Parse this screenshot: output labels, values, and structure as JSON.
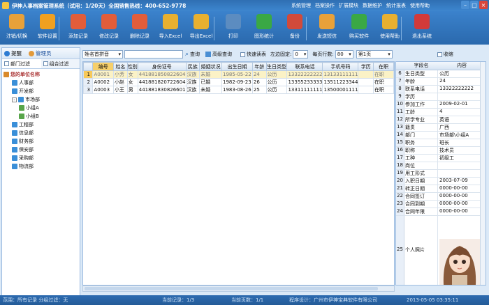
{
  "app": {
    "title": "伊神人事档案管理系统（试用：1/20天）全国销售热线：400-652-9778"
  },
  "menu": [
    "系统管理",
    "档案操作",
    "扩展模块",
    "数据维护",
    "统计报表",
    "使用帮助"
  ],
  "toolbar": [
    {
      "label": "注销/切换",
      "icon": "logout-switch-icon",
      "color": "#e8a13a"
    },
    {
      "label": "软件设置",
      "icon": "settings-gear-icon",
      "color": "#f0a020"
    },
    {
      "label": "添加记录",
      "icon": "add-record-icon",
      "color": "#e25d3a"
    },
    {
      "label": "修改记录",
      "icon": "edit-record-icon",
      "color": "#e25d3a"
    },
    {
      "label": "删除记录",
      "icon": "delete-record-icon",
      "color": "#e25d3a"
    },
    {
      "label": "导入Excel",
      "icon": "import-excel-icon",
      "color": "#e8b030"
    },
    {
      "label": "导出Excel",
      "icon": "export-excel-icon",
      "color": "#e8b030"
    },
    {
      "label": "打印",
      "icon": "print-icon",
      "color": "#5c8cc0"
    },
    {
      "label": "图形统计",
      "icon": "chart-stats-icon",
      "color": "#3aa845"
    },
    {
      "label": "备份",
      "icon": "backup-icon",
      "color": "#d24a3a"
    },
    {
      "label": "发送短信",
      "icon": "sms-envelope-icon",
      "color": "#e8a13a"
    },
    {
      "label": "购买软件",
      "icon": "buy-dollar-icon",
      "color": "#3aa845"
    },
    {
      "label": "使用帮助",
      "icon": "help-icon",
      "color": "#e8b030"
    },
    {
      "label": "退出系统",
      "icon": "exit-icon",
      "color": "#d23a3a"
    }
  ],
  "left": {
    "remind": "提醒",
    "admin": "管理员",
    "tab_dept": "部门过滤",
    "tab_group": "组合过滤",
    "tree": [
      {
        "label": "您的单位名称",
        "level": 0,
        "bold": true
      },
      {
        "label": "人事部",
        "level": 1
      },
      {
        "label": "开发部",
        "level": 1
      },
      {
        "label": "市场部",
        "level": 1,
        "plus": true
      },
      {
        "label": "小组A",
        "level": 2
      },
      {
        "label": "小组B",
        "level": 2
      },
      {
        "label": "工程部",
        "level": 1
      },
      {
        "label": "信息部",
        "level": 1
      },
      {
        "label": "财务部",
        "level": 1
      },
      {
        "label": "保安部",
        "level": 1
      },
      {
        "label": "采购部",
        "level": 1
      },
      {
        "label": "物流部",
        "level": 1
      }
    ]
  },
  "search": {
    "field": "姓名首拼音",
    "query_btn": "查询",
    "adv_btn": "高级查询",
    "quick_table": "快速读表",
    "left_fix_label": "左边固定:",
    "left_fix_value": "0",
    "per_page_label": "每页行数:",
    "per_page_value": "80",
    "page_value": "第1页",
    "collapse": "收缩"
  },
  "grid": {
    "headers": [
      "",
      "编号",
      "姓名",
      "性别",
      "身份证号",
      "民族",
      "婚姻状况",
      "出生日期",
      "年龄",
      "生日类型",
      "联系电话",
      "手机号码",
      "学历",
      "在职"
    ],
    "rows": [
      [
        "1",
        "A0001",
        "小芳",
        "女",
        "441881850822604",
        "汉族",
        "未婚",
        "1985-05-22",
        "24",
        "公历",
        "13322222222",
        "13133111111",
        "",
        "在职"
      ],
      [
        "2",
        "A0002",
        "小赵",
        "女",
        "441881820722604",
        "汉族",
        "已婚",
        "1982-09-23",
        "26",
        "公历",
        "13355233333",
        "13511223344",
        "",
        "在职"
      ],
      [
        "3",
        "A0003",
        "小王",
        "男",
        "441881830826601",
        "汉族",
        "未婚",
        "1983-08-26",
        "25",
        "公历",
        "13311111111",
        "13500001111",
        "",
        "在职"
      ]
    ]
  },
  "detail": {
    "head_field": "字段名",
    "head_value": "内容",
    "rows": [
      [
        "6",
        "生日类型",
        "公历"
      ],
      [
        "7",
        "年龄",
        "24"
      ],
      [
        "8",
        "联系电话",
        "13322222222"
      ],
      [
        "9",
        "学历",
        ""
      ],
      [
        "10",
        "参加工作",
        "2009-02-01"
      ],
      [
        "11",
        "工龄",
        "4"
      ],
      [
        "12",
        "所学专业",
        "英语"
      ],
      [
        "13",
        "籍贯",
        "广西"
      ],
      [
        "14",
        "部门",
        "市场部\\小组A"
      ],
      [
        "15",
        "职务",
        "班长"
      ],
      [
        "16",
        "职称",
        "技术员"
      ],
      [
        "17",
        "工种",
        "初级工"
      ],
      [
        "18",
        "岗位",
        ""
      ],
      [
        "19",
        "用工形式",
        ""
      ],
      [
        "20",
        "入职日期",
        "2003-07-09"
      ],
      [
        "21",
        "转正日期",
        "0000-00-00"
      ],
      [
        "22",
        "合同签订",
        "0000-00-00"
      ],
      [
        "23",
        "合同到期",
        "0000-00-00"
      ],
      [
        "24",
        "合同年限",
        "0000-00-00"
      ]
    ],
    "photo_row": "25",
    "photo_label": "个人照片"
  },
  "status": {
    "scope": "范围：所有记录  分组过滤：无",
    "current": "当前记录：1/3",
    "pages": "当前页数：1/1",
    "designer": "程序设计：广州市伊神宝典软件有限公司",
    "datetime": "2013-05-05 03:35:11"
  }
}
